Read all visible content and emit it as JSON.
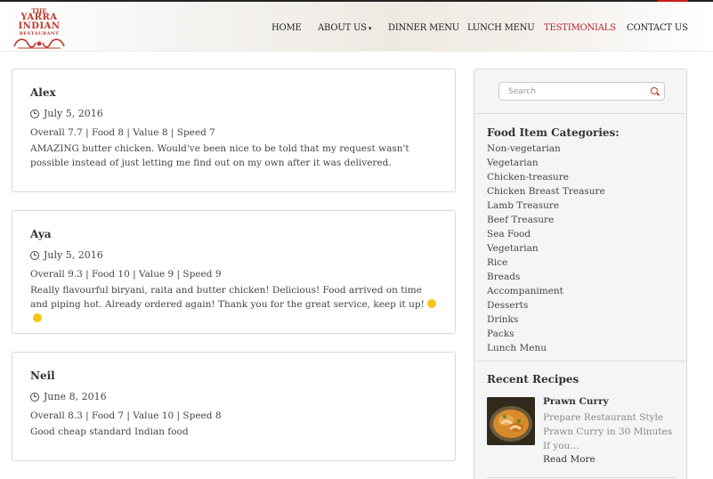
{
  "brand": {
    "line1": "THE",
    "line2": "YARRA",
    "line3": "INDIAN",
    "line4": "RESTAURANT",
    "color": "#c0392b"
  },
  "nav": {
    "items": [
      {
        "label": "HOME"
      },
      {
        "label": "ABOUT US"
      },
      {
        "label": "DINNER MENU"
      },
      {
        "label": "LUNCH MENU"
      },
      {
        "label": "TESTIMONIALS"
      },
      {
        "label": "CONTACT US"
      }
    ],
    "active_color": "#b8242b"
  },
  "testimonials": [
    {
      "name": "Alex",
      "date": "July 5, 2016",
      "ratings": "Overall 7.7 | Food 8 | Value 8 | Speed 7",
      "text": "AMAZING butter chicken. Would've been nice to be told that my request wasn't possible instead of just letting me find out on my own after it was delivered."
    },
    {
      "name": "Aya",
      "date": "July 5, 2016",
      "ratings": "Overall 9.3 | Food 10 | Value 9 | Speed 9",
      "text": "Really flavourful biryani, raita and butter chicken! Delicious! Food arrived on time and piping hot. Already ordered again! Thank you for the great service, keep it up!"
    },
    {
      "name": "Neil",
      "date": "June 8, 2016",
      "ratings": "Overall 8.3 | Food 7 | Value 10 | Speed 8",
      "text": "Good cheap standard Indian food"
    }
  ],
  "sidebar": {
    "search_placeholder": "Search",
    "categories_title": "Food Item Categories:",
    "categories": [
      "Non-vegetarian",
      "Vegetarian",
      "Chicken-treasure",
      "Chicken Breast Treasure",
      "Lamb Treasure",
      "Beef Treasure",
      "Sea Food",
      "Vegetarian",
      "Rice",
      "Breads",
      "Accompaniment",
      "Desserts",
      "Drinks",
      "Packs",
      "Lunch Menu"
    ],
    "recent_title": "Recent Recipes",
    "recipe": {
      "name": "Prawn Curry",
      "description": "Prepare Restaurant Style Prawn Curry in 30 Minutes If you…",
      "read_more": "Read More"
    }
  }
}
